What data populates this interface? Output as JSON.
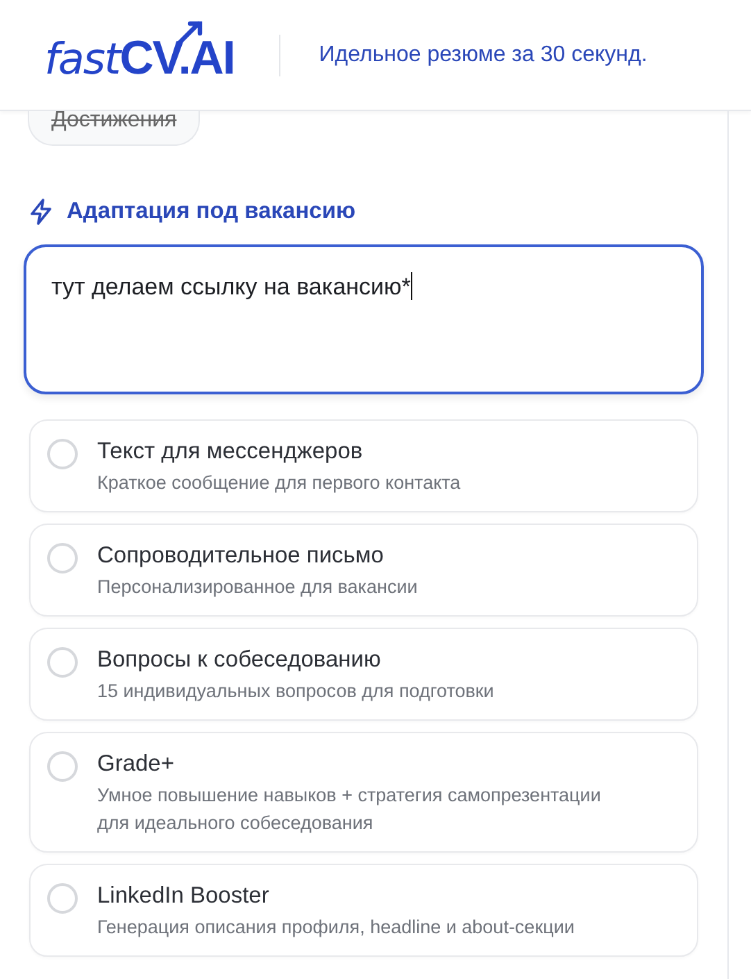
{
  "header": {
    "logo": {
      "light": "fast",
      "bold": "CV.AI"
    },
    "tagline": "Идельное резюме за 30 секунд."
  },
  "chip": {
    "label": "Достижения",
    "struck_through": true
  },
  "section": {
    "title": "Адаптация под вакансию"
  },
  "vacancy_field": {
    "value": "тут делаем ссылку на вакансию*",
    "focused": true
  },
  "options": [
    {
      "title": "Текст для мессенджеров",
      "description": "Краткое сообщение для первого контакта",
      "selected": false
    },
    {
      "title": "Сопроводительное письмо",
      "description": "Персонализированное для вакансии",
      "selected": false
    },
    {
      "title": "Вопросы к собеседованию",
      "description": "15 индивидуальных вопросов для подготовки",
      "selected": false
    },
    {
      "title": "Grade+",
      "description": "Умное повышение навыков + стратегия самопрезентации для идеального собеседования",
      "selected": false
    },
    {
      "title": "LinkedIn Booster",
      "description": "Генерация описания профиля, headline и about-секции",
      "selected": false
    }
  ]
}
